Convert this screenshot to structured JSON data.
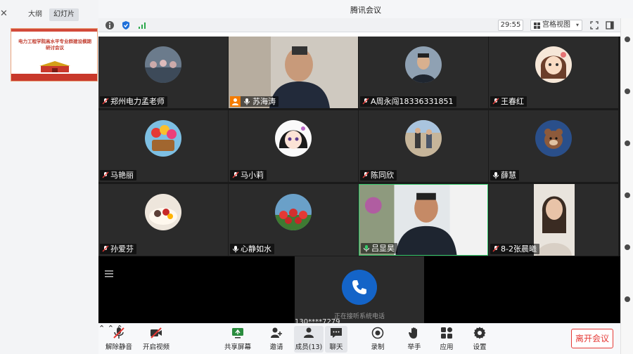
{
  "app": {
    "title": "腾讯会议"
  },
  "left_panel": {
    "tabs": [
      "大纲",
      "幻灯片"
    ],
    "slide_text": "电力工程学院高水平专业群建设模期研讨会议"
  },
  "toolbar": {
    "timer": "29:55",
    "layout_label": "宫格视图",
    "icons": [
      "info-icon",
      "shield-icon",
      "signal-icon",
      "fullscreen-icon",
      "sidebar-icon",
      "restore-icon"
    ]
  },
  "participants": [
    {
      "name": "郑州电力孟老师",
      "avatar": "photo-crowd"
    },
    {
      "name": "苏海涛",
      "avatar": "camera-man-glasses"
    },
    {
      "name": "A周永闯18336331851",
      "avatar": "photo-man-suit"
    },
    {
      "name": "王春红",
      "avatar": "cartoon-girl"
    },
    {
      "name": "马艳丽",
      "avatar": "flowers-basket"
    },
    {
      "name": "马小莉",
      "avatar": "anime-girl"
    },
    {
      "name": "陈同欣",
      "avatar": "photo-two-people"
    },
    {
      "name": "薛慧",
      "avatar": "cartoon-bear"
    },
    {
      "name": "孙爱芬",
      "avatar": "cake"
    },
    {
      "name": "心静如水",
      "avatar": "red-tulips"
    },
    {
      "name": "吕显昊",
      "avatar": "camera-man-speaking"
    },
    {
      "name": "8-2张晨曦",
      "avatar": "camera-woman"
    }
  ],
  "call": {
    "status": "正在接听系统电话",
    "number": "130****7279"
  },
  "bottom_toolbar": {
    "unmute": "解除静音",
    "start_video": "开启视频",
    "share_screen": "共享屏幕",
    "invite": "邀请",
    "members": "成员(13)",
    "chat": "聊天",
    "record": "录制",
    "raise_hand": "举手",
    "apps": "应用",
    "settings": "设置",
    "leave": "离开会议"
  },
  "colors": {
    "accent_blue": "#1464c8",
    "leave_red": "#e53935",
    "active_green": "#35c96b",
    "speaking_orange": "#f57c00"
  }
}
